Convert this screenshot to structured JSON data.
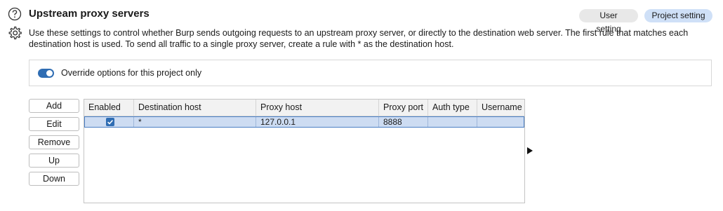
{
  "header": {
    "title": "Upstream proxy servers",
    "user_setting_label": "User setting",
    "project_setting_label": "Project setting",
    "description": "Use these settings to control whether Burp sends outgoing requests to an upstream proxy server, or directly to the destination web server. The first rule that matches each destination host is used. To send all traffic to a single proxy server, create a rule with * as the destination host."
  },
  "override": {
    "label": "Override options for this project only",
    "enabled": true
  },
  "buttons": {
    "add": "Add",
    "edit": "Edit",
    "remove": "Remove",
    "up": "Up",
    "down": "Down"
  },
  "table": {
    "columns": [
      "Enabled",
      "Destination host",
      "Proxy host",
      "Proxy port",
      "Auth type",
      "Username"
    ],
    "rows": [
      {
        "enabled": true,
        "destination_host": "*",
        "proxy_host": "127.0.0.1",
        "proxy_port": "8888",
        "auth_type": "",
        "username": ""
      }
    ]
  },
  "icons": {
    "help": "help-icon",
    "settings": "gear-icon",
    "expand": "arrow-right-icon"
  },
  "colors": {
    "accent": "#2f6db3",
    "selected_row": "#cddcf2",
    "project_pill": "#cfe0f7"
  }
}
